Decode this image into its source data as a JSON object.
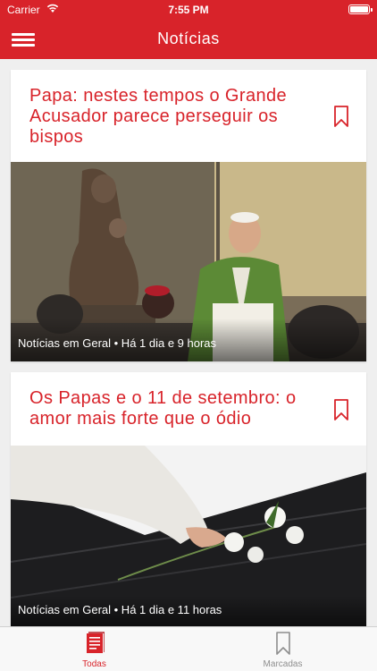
{
  "status_bar": {
    "carrier": "Carrier",
    "time": "7:55 PM"
  },
  "header": {
    "title": "Notícias"
  },
  "articles": [
    {
      "headline": "Papa: nestes tempos o Grande Acusador parece perseguir os bispos",
      "meta": "Notícias em Geral • Há 1 dia e 9 horas"
    },
    {
      "headline": "Os Papas e o 11 de setembro: o amor mais forte que o ódio",
      "meta": "Notícias em Geral • Há 1 dia e 11 horas"
    }
  ],
  "tab_bar": {
    "tabs": [
      {
        "label": "Todas",
        "icon": "newspaper-icon",
        "active": true
      },
      {
        "label": "Marcadas",
        "icon": "bookmark-icon",
        "active": false
      }
    ]
  },
  "colors": {
    "accent": "#d8232a",
    "background": "#efefef",
    "tab_inactive": "#8e8e8e"
  }
}
